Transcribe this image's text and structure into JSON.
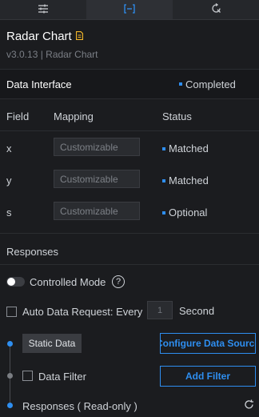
{
  "tabs": [
    {
      "icon": "sliders-icon"
    },
    {
      "icon": "data-interface-icon",
      "active": true
    },
    {
      "icon": "interaction-icon"
    }
  ],
  "header": {
    "title": "Radar Chart",
    "subtitle": "v3.0.13 | Radar Chart"
  },
  "data_interface": {
    "title": "Data Interface",
    "status": "Completed"
  },
  "columns": {
    "field": "Field",
    "mapping": "Mapping",
    "status": "Status"
  },
  "fields": [
    {
      "name": "x",
      "placeholder": "Customizable",
      "status": "Matched"
    },
    {
      "name": "y",
      "placeholder": "Customizable",
      "status": "Matched"
    },
    {
      "name": "s",
      "placeholder": "Customizable",
      "status": "Optional"
    }
  ],
  "responses": {
    "title": "Responses",
    "controlled_mode": "Controlled Mode",
    "help": "?",
    "auto_request": "Auto Data Request: Every",
    "interval": "1",
    "interval_unit": "Second",
    "static_data": "Static Data",
    "configure_button": "Configure Data Source",
    "data_filter": "Data Filter",
    "add_filter_button": "Add Filter",
    "readonly": "Responses ( Read-only )"
  },
  "colors": {
    "accent": "#2e8ef0",
    "background": "#1b1c1f",
    "title_icon": "#f0b429"
  }
}
